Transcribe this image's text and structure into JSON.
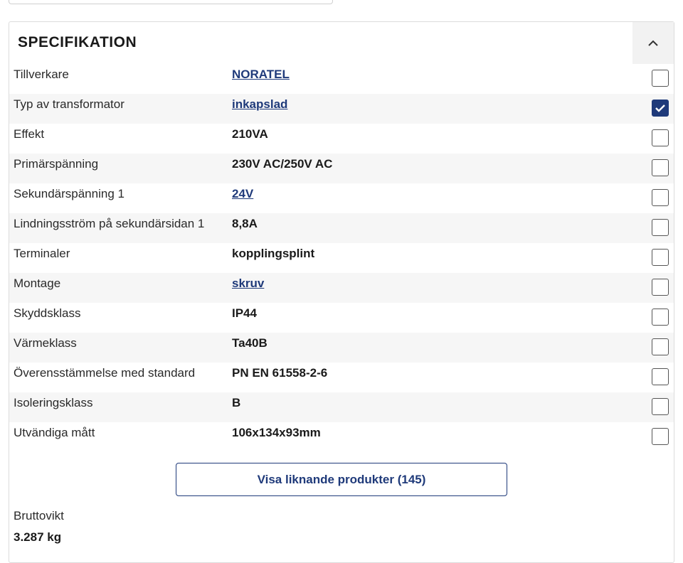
{
  "panel": {
    "title": "SPECIFIKATION"
  },
  "specs": [
    {
      "label": "Tillverkare",
      "value": "NORATEL",
      "link": true,
      "checked": false
    },
    {
      "label": "Typ av transformator",
      "value": "inkapslad",
      "link": true,
      "checked": true
    },
    {
      "label": "Effekt",
      "value": "210VA",
      "link": false,
      "checked": false
    },
    {
      "label": "Primärspänning",
      "value": "230V AC/250V AC",
      "link": false,
      "checked": false
    },
    {
      "label": "Sekundärspänning 1",
      "value": "24V",
      "link": true,
      "checked": false
    },
    {
      "label": "Lindningsström på sekundärsidan 1",
      "value": "8,8A",
      "link": false,
      "checked": false
    },
    {
      "label": "Terminaler",
      "value": "kopplingsplint",
      "link": false,
      "checked": false
    },
    {
      "label": "Montage",
      "value": "skruv",
      "link": true,
      "checked": false
    },
    {
      "label": "Skyddsklass",
      "value": "IP44",
      "link": false,
      "checked": false
    },
    {
      "label": "Värmeklass",
      "value": "Ta40B",
      "link": false,
      "checked": false
    },
    {
      "label": "Överensstämmelse med standard",
      "value": "PN EN 61558-2-6",
      "link": false,
      "checked": false
    },
    {
      "label": "Isoleringsklass",
      "value": "B",
      "link": false,
      "checked": false
    },
    {
      "label": "Utvändiga mått",
      "value": "106x134x93mm",
      "link": false,
      "checked": false
    }
  ],
  "similar_button": {
    "label": "Visa liknande produkter (145)"
  },
  "weight": {
    "label": "Bruttovikt",
    "value": "3.287 kg"
  },
  "colors": {
    "accent": "#1f3a7a",
    "row_alt": "#f6f6f6"
  }
}
